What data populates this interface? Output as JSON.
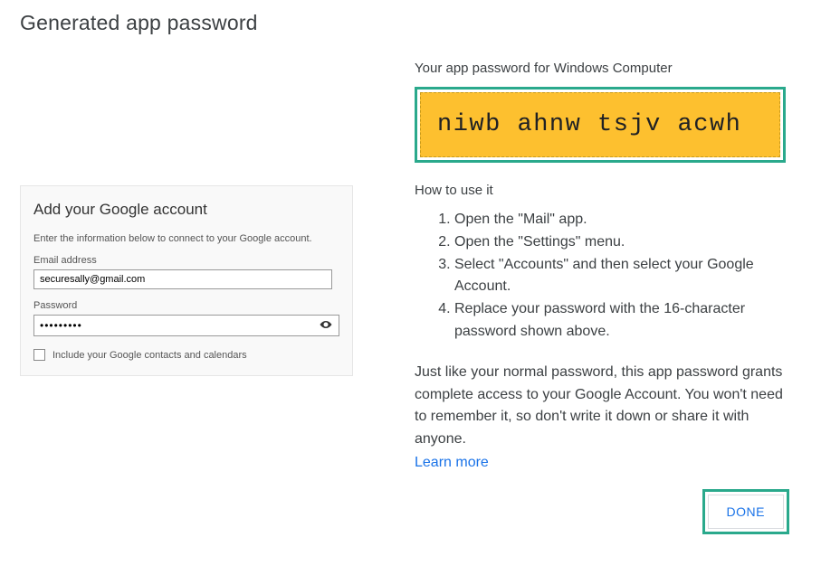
{
  "page_title": "Generated app password",
  "right": {
    "label": "Your app password for Windows Computer",
    "generated_password": "niwb ahnw tsjv acwh",
    "how_title": "How to use it",
    "steps": [
      "Open the \"Mail\" app.",
      "Open the \"Settings\" menu.",
      "Select \"Accounts\" and then select your Google Account.",
      "Replace your password with the 16-character password shown above."
    ],
    "footer_text": "Just like your normal password, this app password grants complete access to your Google Account. You won't need to remember it, so don't write it down or share it with anyone.",
    "learn_more": "Learn more",
    "done_label": "DONE"
  },
  "account_card": {
    "title": "Add your Google account",
    "subtitle": "Enter the information below to connect to your Google account.",
    "email_label": "Email address",
    "email_value": "securesally@gmail.com",
    "password_label": "Password",
    "password_value": "•••••••••",
    "checkbox_label": "Include your Google contacts and calendars"
  }
}
